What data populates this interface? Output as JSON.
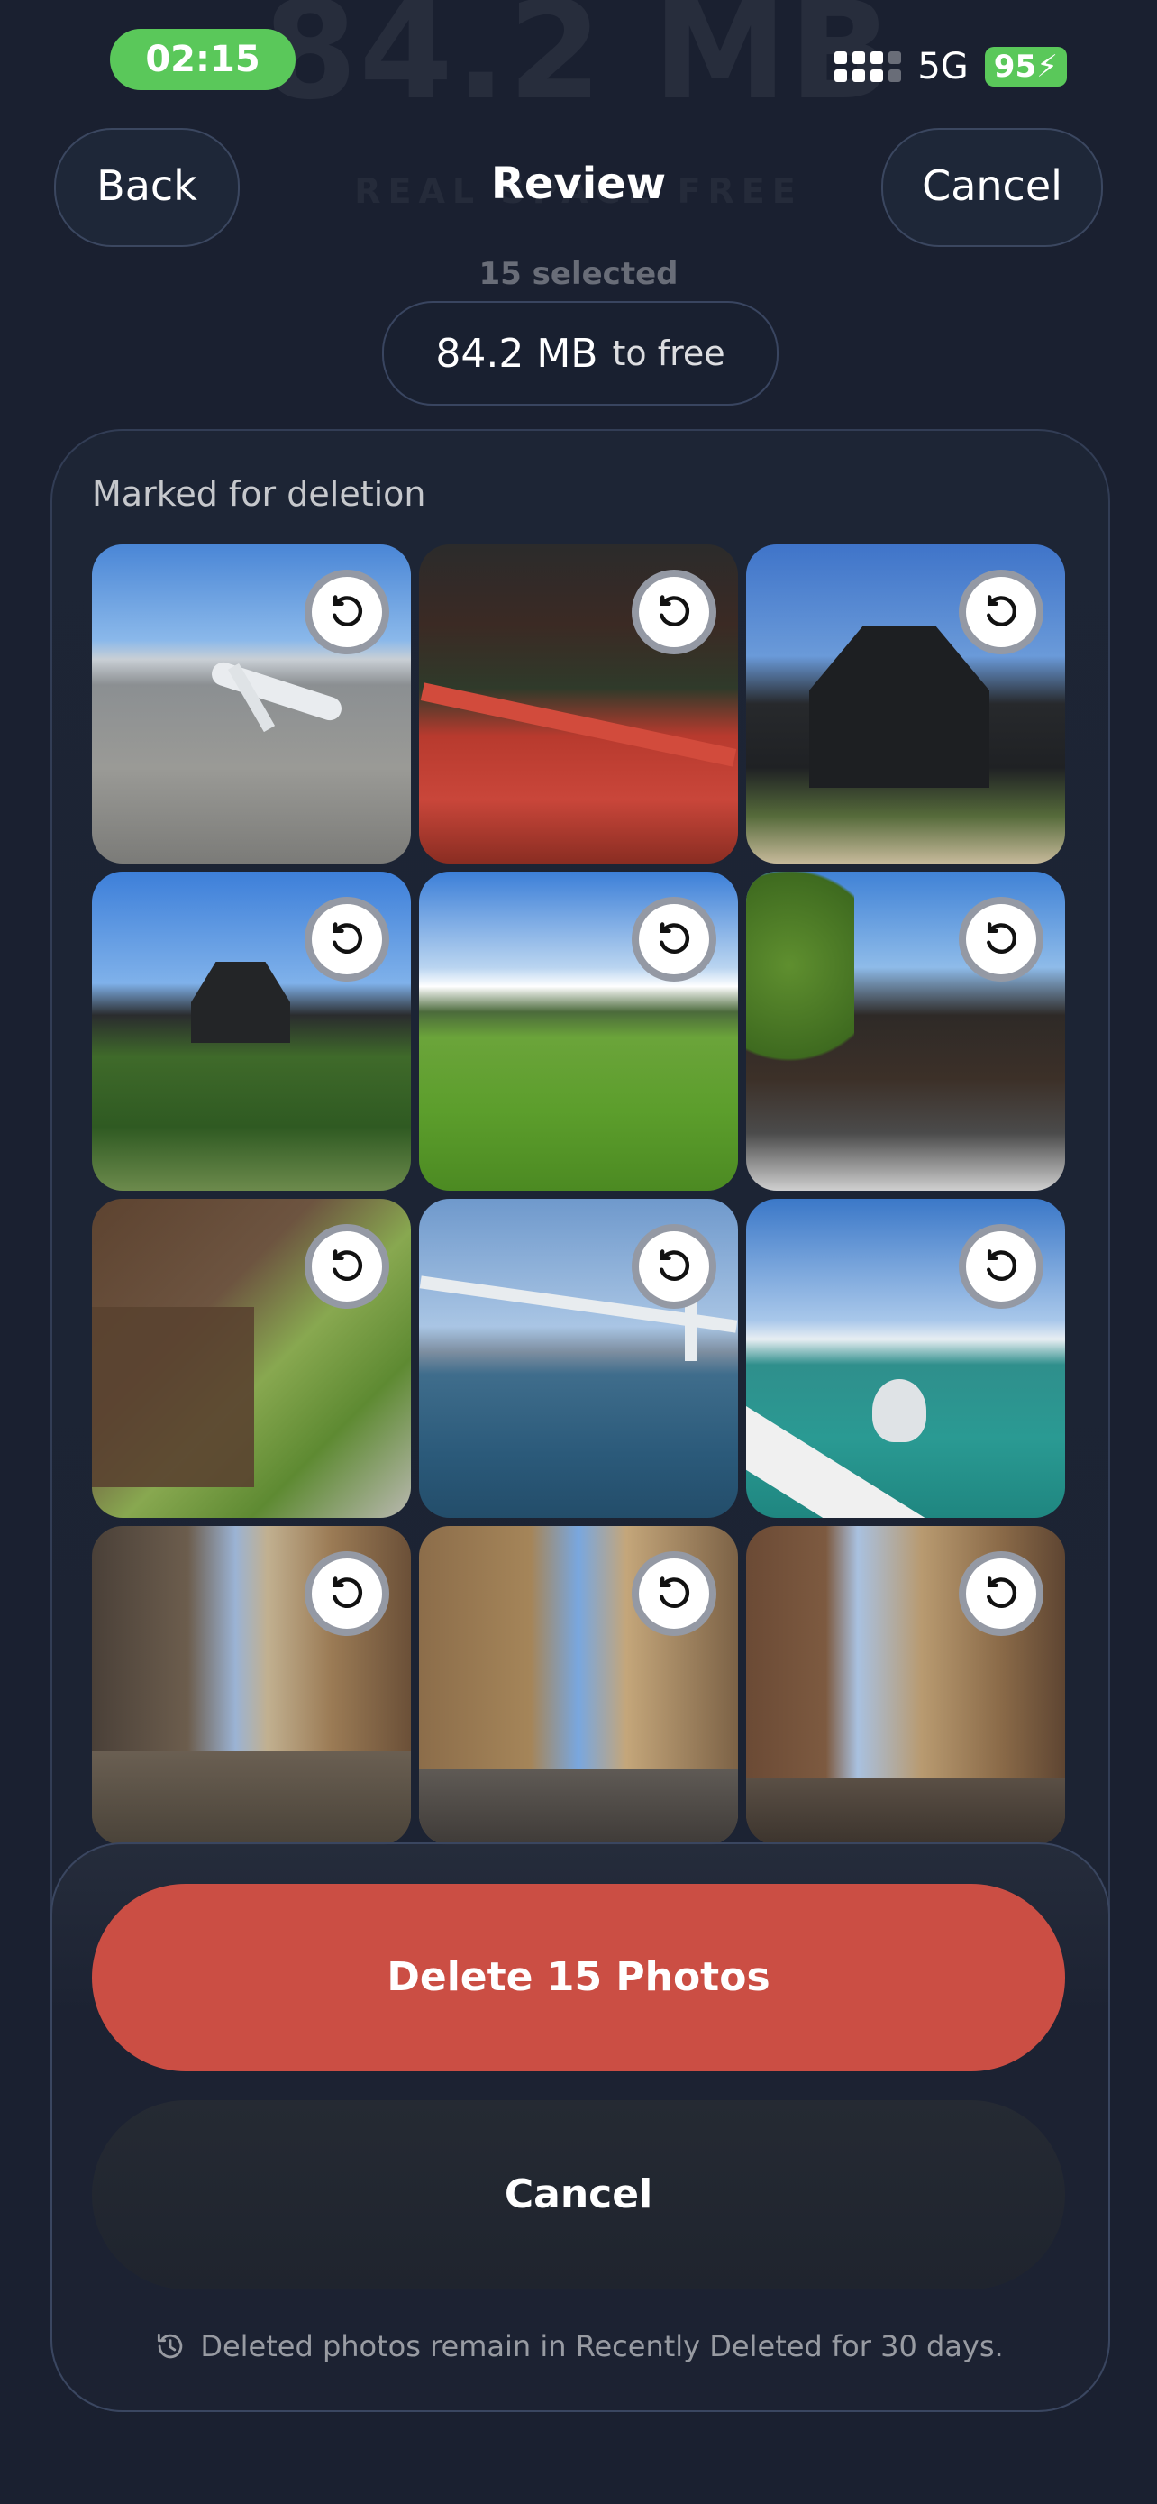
{
  "background_header": {
    "size_text": "84.2 MB",
    "sub_text": "REAL SPACE FREE"
  },
  "status_bar": {
    "time": "02:15",
    "network": "5G",
    "battery": "95"
  },
  "nav": {
    "back_label": "Back",
    "title": "Review",
    "cancel_label": "Cancel"
  },
  "selection": {
    "count_text": "15 selected",
    "size_value": "84.2 MB",
    "size_suffix": "to free"
  },
  "section_label": "Marked for deletion",
  "photos": [
    {
      "name": "airport-photo"
    },
    {
      "name": "red-bridge-temple-photo"
    },
    {
      "name": "black-castle-photo"
    },
    {
      "name": "castle-on-hill-photo"
    },
    {
      "name": "rice-field-photo"
    },
    {
      "name": "shrine-roof-photo"
    },
    {
      "name": "wooden-temple-photo"
    },
    {
      "name": "suspension-bridge-photo"
    },
    {
      "name": "seagull-photo"
    },
    {
      "name": "narrow-street-photo-1"
    },
    {
      "name": "narrow-street-photo-2"
    },
    {
      "name": "narrow-street-photo-3"
    }
  ],
  "actions": {
    "delete_label": "Delete 15 Photos",
    "cancel_label": "Cancel"
  },
  "footer_note": "Deleted photos remain in Recently Deleted for 30 days.",
  "colors": {
    "background": "#1a2030",
    "delete": "#cb4e44",
    "accent_green": "#5ac85a"
  }
}
